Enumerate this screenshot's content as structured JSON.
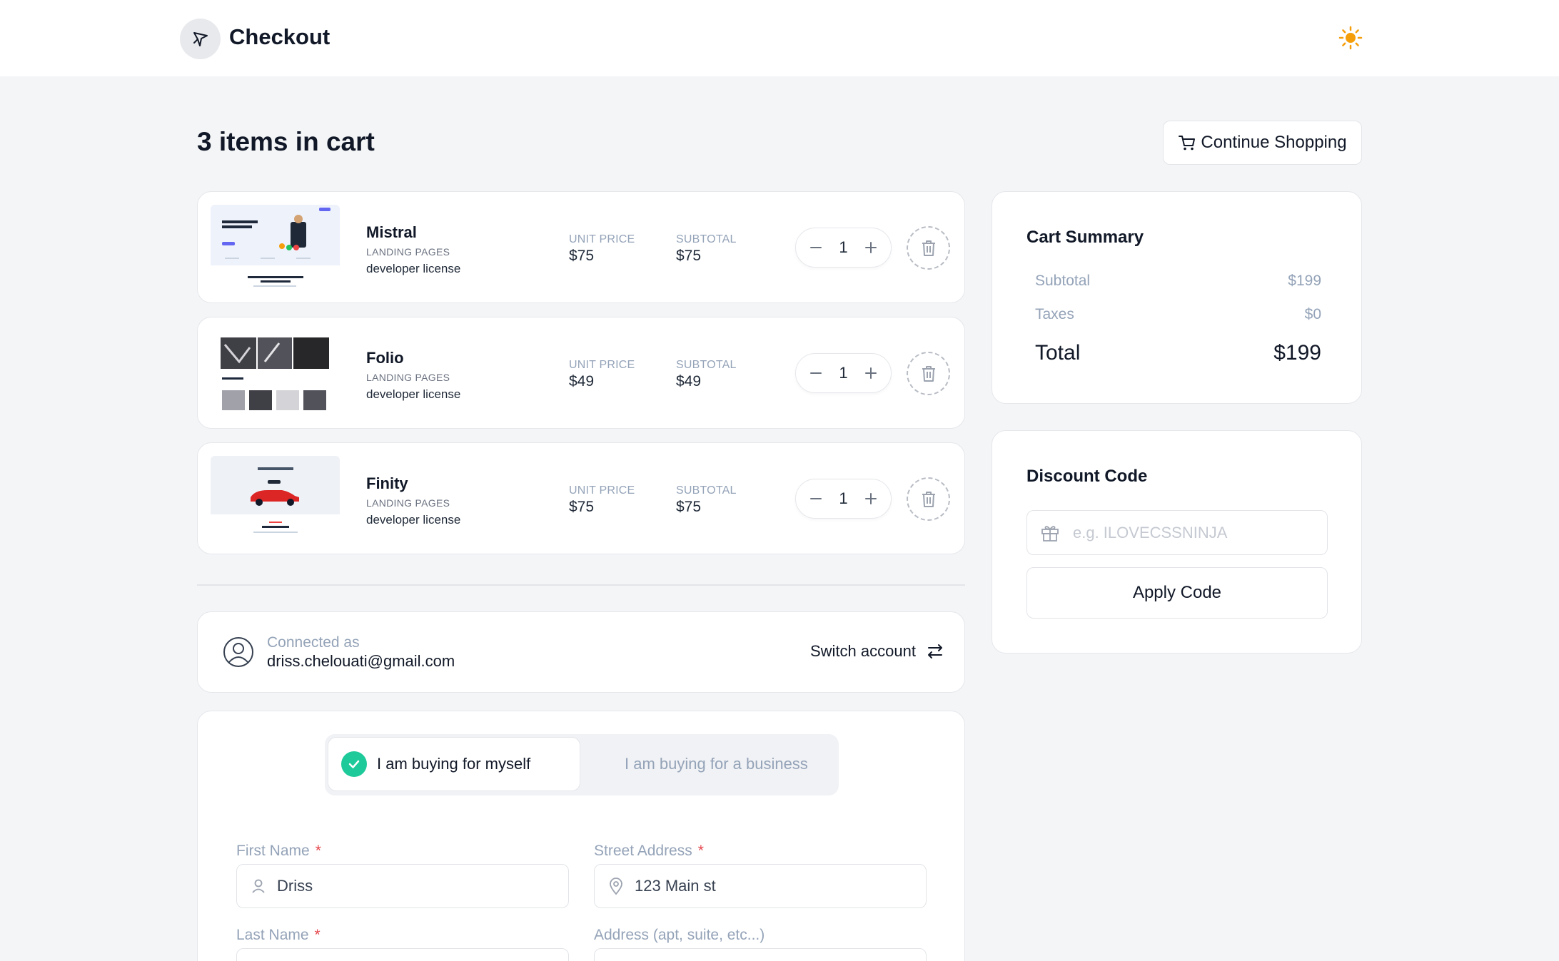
{
  "header": {
    "title": "Checkout",
    "logo_icon": "compass-star-icon",
    "theme_icon": "sun-icon",
    "accent": "#f59e0b"
  },
  "cart": {
    "heading": "3 items in cart",
    "continue_label": "Continue Shopping",
    "unit_price_label": "UNIT PRICE",
    "subtotal_label": "SUBTOTAL",
    "items": [
      {
        "name": "Mistral",
        "category": "LANDING PAGES",
        "license": "developer license",
        "unit_price": "$75",
        "subtotal": "$75",
        "quantity": "1"
      },
      {
        "name": "Folio",
        "category": "LANDING PAGES",
        "license": "developer license",
        "unit_price": "$49",
        "subtotal": "$49",
        "quantity": "1"
      },
      {
        "name": "Finity",
        "category": "LANDING PAGES",
        "license": "developer license",
        "unit_price": "$75",
        "subtotal": "$75",
        "quantity": "1"
      }
    ]
  },
  "account": {
    "label": "Connected as",
    "email": "driss.chelouati@gmail.com",
    "switch_label": "Switch account"
  },
  "buyer": {
    "option_self": "I am buying for myself",
    "option_business": "I am buying for a business",
    "check_color": "#1ec99a"
  },
  "form": {
    "first_name_label": "First Name",
    "first_name_value": "Driss",
    "street_label": "Street Address",
    "street_value": "123 Main st",
    "last_name_label": "Last Name",
    "address2_label": "Address (apt, suite, etc...)",
    "required_mark": "*"
  },
  "summary": {
    "title": "Cart Summary",
    "subtotal_label": "Subtotal",
    "subtotal_value": "$199",
    "taxes_label": "Taxes",
    "taxes_value": "$0",
    "total_label": "Total",
    "total_value": "$199"
  },
  "discount": {
    "title": "Discount Code",
    "placeholder": "e.g. ILOVECSSNINJA",
    "apply_label": "Apply Code"
  }
}
